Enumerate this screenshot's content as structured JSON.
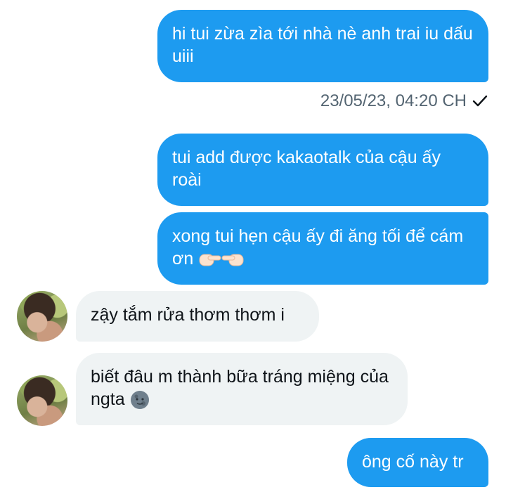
{
  "messages": [
    {
      "text": "hi tui zừa zìa tới nhà nè anh trai iu dấu uiii"
    },
    {
      "text": "tui add được kakaotalk của cậu ấy roài"
    },
    {
      "text": "xong tui hẹn cậu ấy đi ăng tối để cám ơn",
      "emoji": "pointing-fingers-emoji"
    },
    {
      "text": "zậy tắm rửa thơm thơm i"
    },
    {
      "text": "biết đâu m thành bữa tráng miệng của ngta",
      "emoji": "new-moon-face-emoji"
    },
    {
      "text": "ông cố này tr"
    }
  ],
  "timestamp": "23/05/23, 04:20 CH",
  "status_icon": "check-icon",
  "colors": {
    "sent": "#1d9bf0",
    "received": "#eff3f4",
    "meta": "#536471"
  }
}
